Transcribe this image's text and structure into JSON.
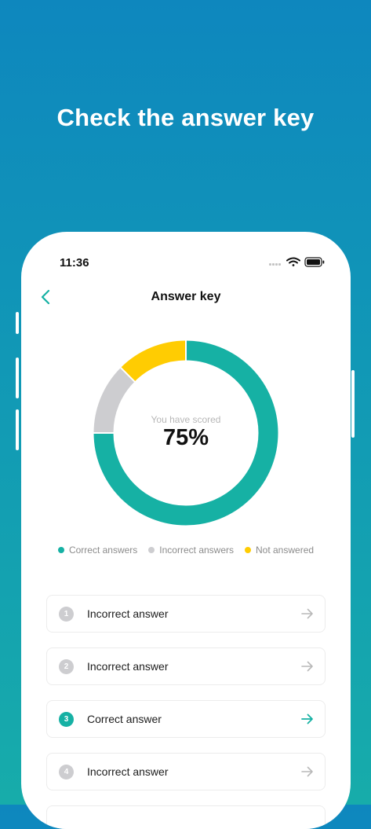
{
  "promo": {
    "title": "Check the answer key"
  },
  "status_bar": {
    "time": "11:36"
  },
  "header": {
    "title": "Answer key"
  },
  "score": {
    "caption": "You have scored",
    "value": "75%",
    "segments": [
      {
        "name": "Correct answers",
        "fraction": 0.75,
        "color": "#16b1a4"
      },
      {
        "name": "Incorrect answers",
        "fraction": 0.125,
        "color": "#cdcdd0"
      },
      {
        "name": "Not answered",
        "fraction": 0.125,
        "color": "#ffcc02"
      }
    ]
  },
  "legend": [
    {
      "label": "Correct answers",
      "color": "#16b1a4"
    },
    {
      "label": "Incorrect answers",
      "color": "#cdcdd0"
    },
    {
      "label": "Not answered",
      "color": "#ffcc02"
    }
  ],
  "questions": [
    {
      "number": "1",
      "label": "Incorrect answer",
      "status": "incorrect"
    },
    {
      "number": "2",
      "label": "Incorrect answer",
      "status": "incorrect"
    },
    {
      "number": "3",
      "label": "Correct answer",
      "status": "correct"
    },
    {
      "number": "4",
      "label": "Incorrect answer",
      "status": "incorrect"
    }
  ],
  "colors": {
    "accent": "#16b1a4",
    "incorrect": "#cdcdd0",
    "unanswered": "#ffcc02",
    "arrow_muted": "#b9b9b9"
  }
}
